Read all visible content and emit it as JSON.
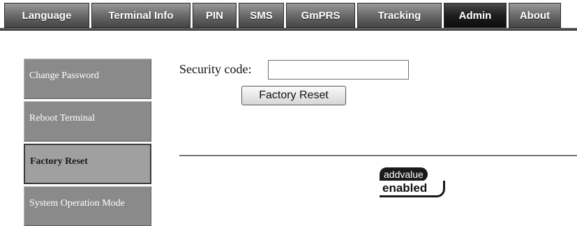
{
  "tabs": [
    {
      "label": "Language"
    },
    {
      "label": "Terminal Info"
    },
    {
      "label": "PIN"
    },
    {
      "label": "SMS"
    },
    {
      "label": "GmPRS"
    },
    {
      "label": "Tracking"
    },
    {
      "label": "Admin",
      "active": true
    },
    {
      "label": "About"
    }
  ],
  "sidebar": {
    "items": [
      {
        "label": "Change Password"
      },
      {
        "label": "Reboot Terminal"
      },
      {
        "label": "Factory Reset",
        "active": true
      },
      {
        "label": "System Operation Mode"
      }
    ]
  },
  "main": {
    "security_label": "Security code:",
    "security_value": "",
    "button_label": "Factory Reset"
  },
  "logo": {
    "top_text": "addvalue",
    "bottom_text": "enabled"
  },
  "colors": {
    "tab_active": "#1e1e1e",
    "tab_inactive": "#6e6e6e",
    "menu_bg": "#8a8a8a"
  }
}
